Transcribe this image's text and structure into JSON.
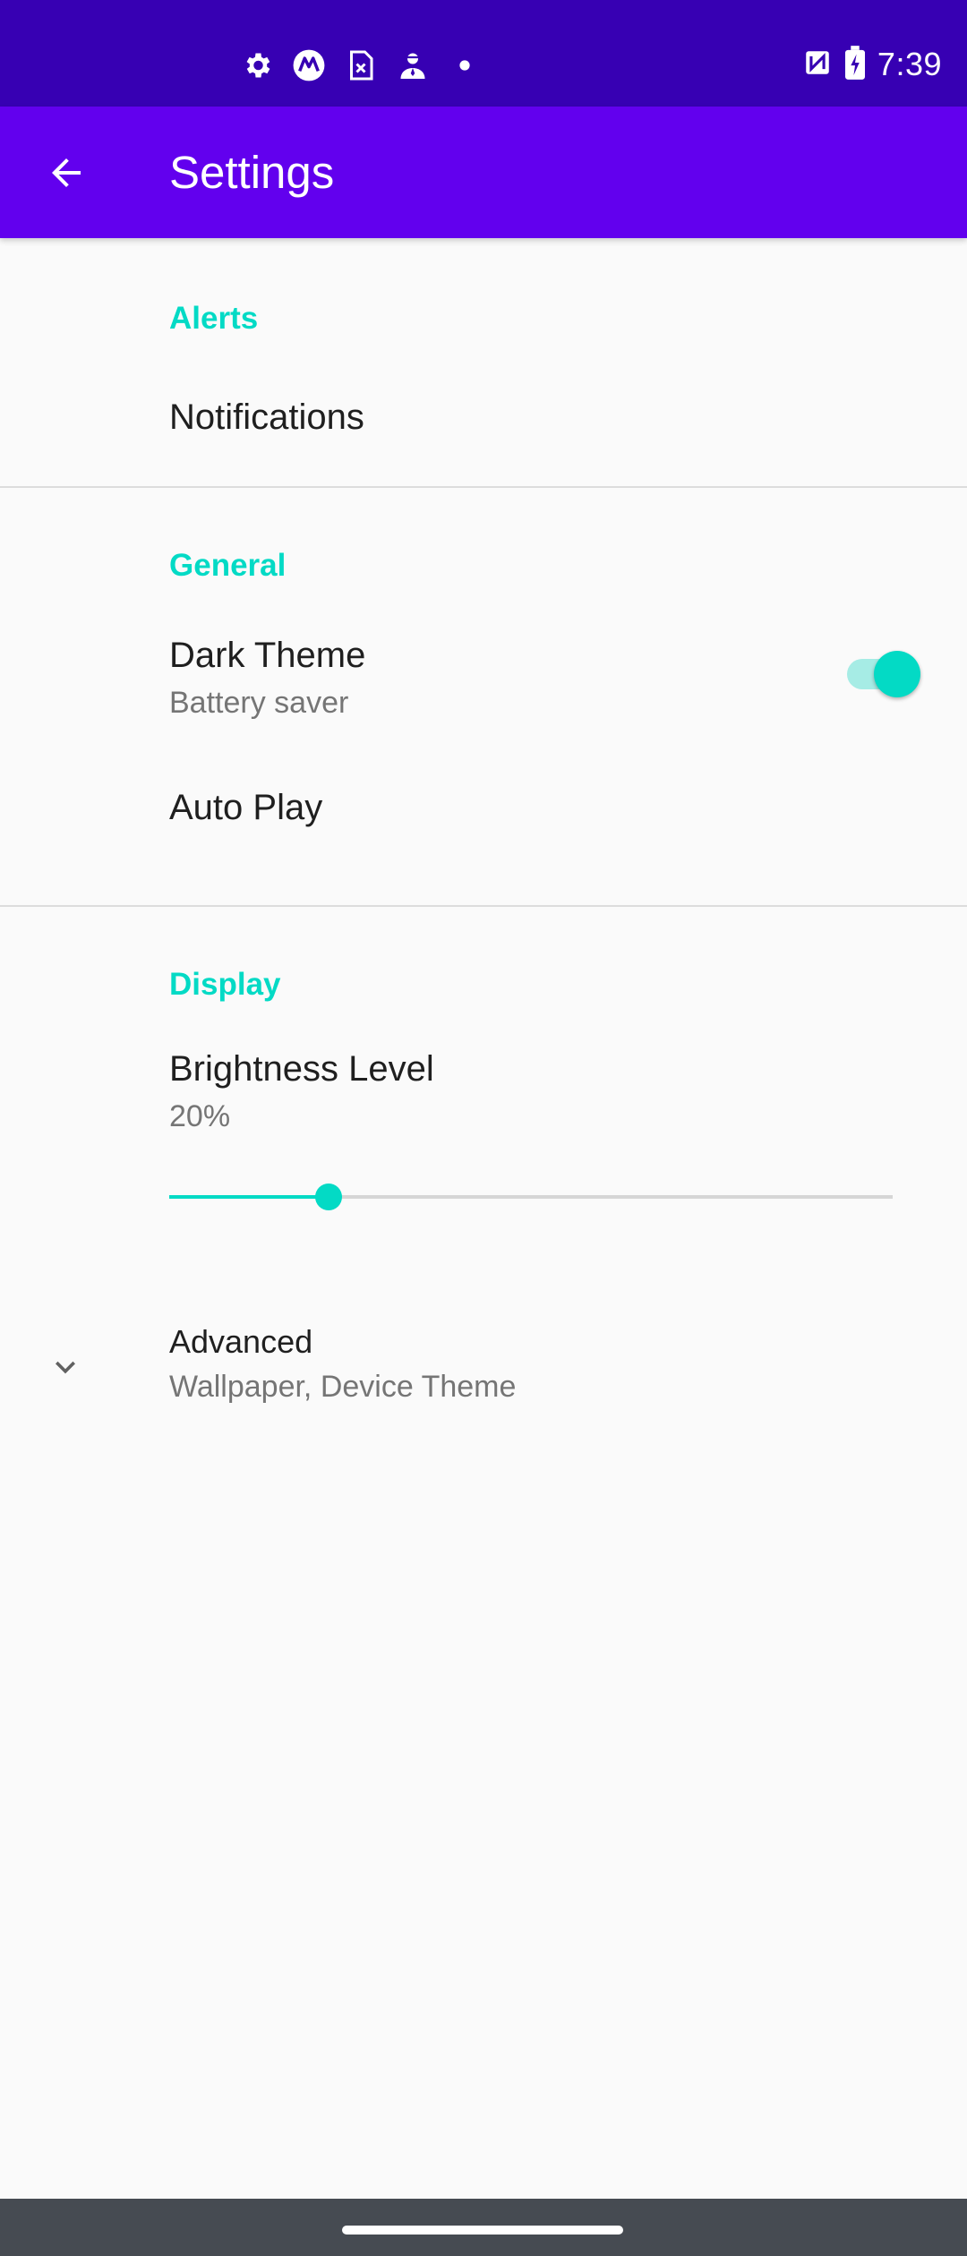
{
  "status_bar": {
    "time": "7:39",
    "left_icons": [
      "settings-icon",
      "motorola-icon",
      "sim-icon",
      "spy-icon",
      "dot-icon"
    ],
    "right_icons": [
      "nfc-icon",
      "battery-charging-icon"
    ],
    "background": "#3700b3"
  },
  "app_bar": {
    "title": "Settings",
    "background": "#6200ee"
  },
  "sections": {
    "alerts": {
      "header": "Alerts",
      "notifications": "Notifications"
    },
    "general": {
      "header": "General",
      "dark_theme_title": "Dark Theme",
      "dark_theme_summary": "Battery saver",
      "dark_theme_on": true,
      "auto_play": "Auto Play"
    },
    "display": {
      "header": "Display",
      "brightness_title": "Brightness Level",
      "brightness_summary": "20%",
      "brightness_value": 0.22
    },
    "advanced": {
      "title": "Advanced",
      "summary": "Wallpaper, Device Theme"
    }
  },
  "colors": {
    "accent": "#03dac5",
    "primary": "#6200ee",
    "primary_dark": "#3700b3"
  }
}
